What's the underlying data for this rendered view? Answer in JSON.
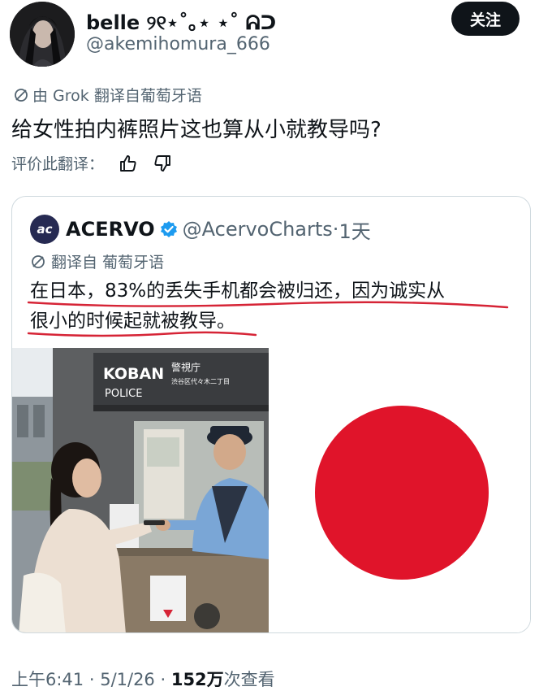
{
  "author": {
    "display_name": "belle ୨୧⋆˚｡⋆ ⋆˚ ᕱᑐ",
    "handle": "@akemihomura_666"
  },
  "follow_button": {
    "label": "关注"
  },
  "translation": {
    "label": "由 Grok 翻译自葡萄牙语",
    "icon": "translate-icon"
  },
  "post": {
    "text": "给女性拍内裤照片这也算从小就教导吗?"
  },
  "rate_translation": {
    "label": "评价此翻译：",
    "thumbs_up_icon": "thumbs-up-icon",
    "thumbs_down_icon": "thumbs-down-icon"
  },
  "quote": {
    "logo_text": "ac",
    "name": "ACERVO",
    "handle": "@AcervoCharts",
    "time": "1天",
    "translation_label": "翻译自 葡萄牙语",
    "text_line1": "在日本，83%的丢失手机都会被归还，因为诚实从",
    "text_line2": "很小的时候起就被教导。",
    "photo_signs": {
      "koban": "KOBAN",
      "police": "POLICE",
      "station": "警視庁",
      "address": "渋谷区代々木二丁目"
    },
    "flag": {
      "disc_color": "#e0142a"
    }
  },
  "meta": {
    "time": "上午6:41",
    "date": "5/1/26",
    "views": "152万",
    "views_label": "次查看"
  },
  "colors": {
    "text": "#0f1419",
    "secondary": "#536471",
    "verified": "#1d9bf0",
    "underline": "#d62436"
  }
}
